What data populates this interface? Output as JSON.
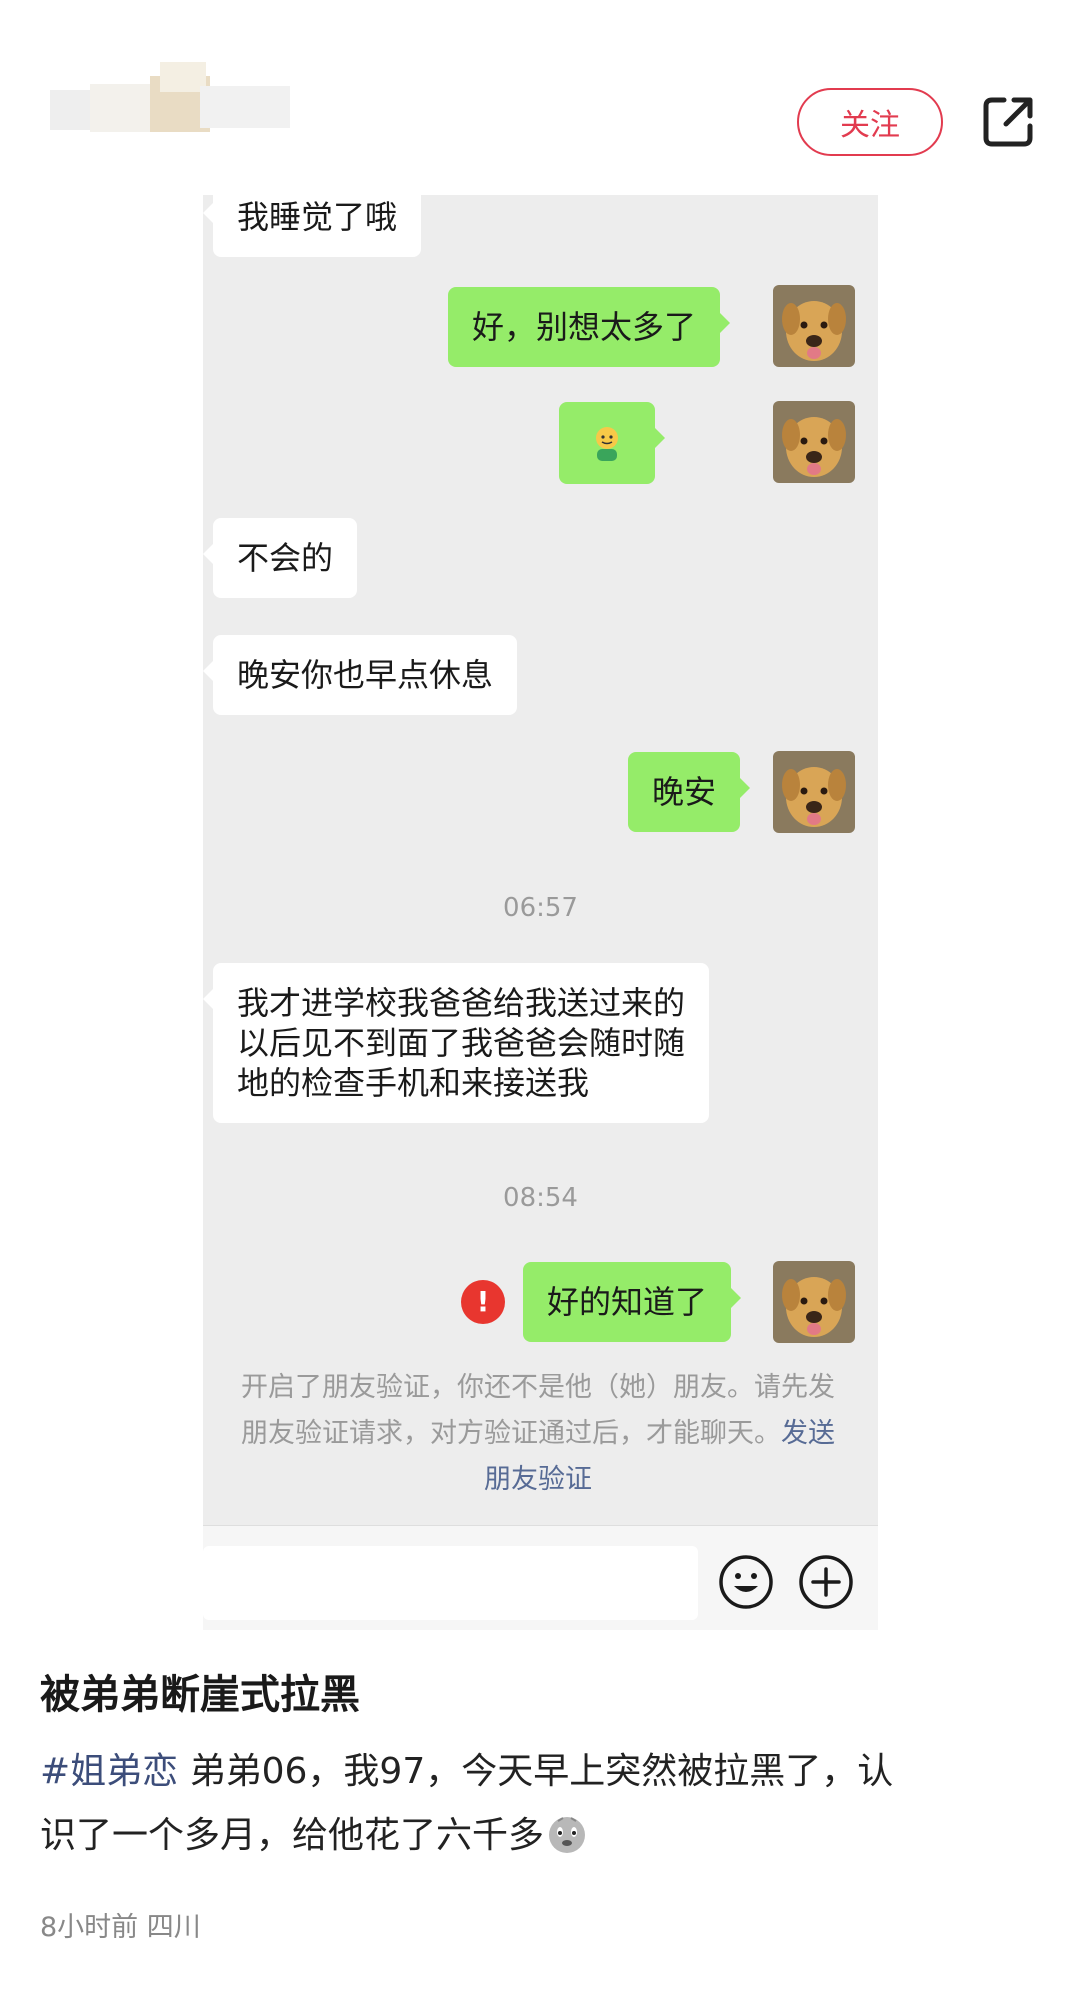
{
  "header": {
    "follow_label": "关注",
    "share_icon": "share-icon"
  },
  "chat": {
    "messages_in": [
      {
        "text": "我睡觉了哦"
      },
      {
        "text": "不会的"
      },
      {
        "text": "晚安你也早点休息"
      }
    ],
    "messages_out": [
      {
        "text": "好，别想太多了"
      },
      {
        "text": "🙂"
      },
      {
        "text": "晚安"
      },
      {
        "text": "好的知道了"
      }
    ],
    "long_message_lines": [
      "我才进学校我爸爸给我送过来的",
      "以后见不到面了我爸爸会随时随",
      "地的检查手机和来接送我"
    ],
    "timestamps": [
      "06:57",
      "08:54"
    ],
    "error_mark": "!",
    "system_notice": {
      "line1": "开启了朋友验证，你还不是他（她）朋友。请先发",
      "line2": "朋友验证请求，对方验证通过后，才能聊天。",
      "link1": "发送",
      "link2": "朋友验证"
    },
    "input_icons": [
      "emoji-icon",
      "plus-icon"
    ]
  },
  "post": {
    "title": "被弟弟断崖式拉黑",
    "tag": "#姐弟恋",
    "body_line1": " 弟弟06，我97，今天早上突然被拉黑了，认",
    "body_line2": "识了一个多月，给他花了六千多",
    "meta": "8小时前 四川"
  },
  "colors": {
    "accent": "#e23b4f",
    "bubble_out": "#95ec69",
    "bubble_in": "#ffffff",
    "chat_bg": "#ededed",
    "link": "#576b95",
    "tag": "#3c4d7a"
  }
}
